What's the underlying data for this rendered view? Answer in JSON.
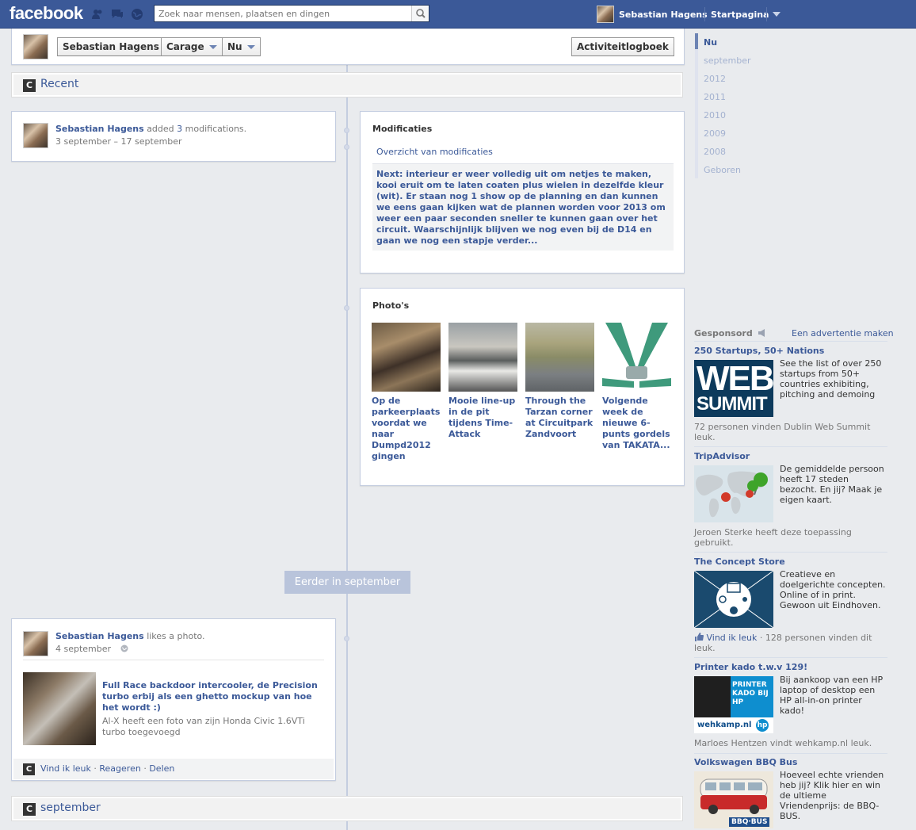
{
  "topbar": {
    "logo": "facebook",
    "search_placeholder": "Zoek naar mensen, plaatsen en dingen",
    "user_name": "Sebastian Hagens",
    "home_label": "Startpagina"
  },
  "cover_bar": {
    "name": "Sebastian Hagens",
    "section": "Carage",
    "time": "Nu",
    "activity_log": "Activiteitlogboek"
  },
  "sections": {
    "recent": "Recent",
    "september": "september"
  },
  "mods_story": {
    "author": "Sebastian Hagens",
    "action_pre": "added",
    "count": "3",
    "action_post": "modifications.",
    "date_range": "3 september – 17 september"
  },
  "mods_card": {
    "title": "Modificaties",
    "link": "Overzicht van modificaties",
    "body": "Next: interieur er weer volledig uit om netjes te maken, kooi eruit om te laten coaten plus wielen in dezelfde kleur (wit). Er staan nog 1 show op de planning en dan kunnen we eens gaan kijken wat de plannen worden voor 2013 om weer een paar seconden sneller te kunnen gaan over het circuit. Waarschijnlijk blijven we nog even bij de D14 en gaan we nog een stapje verder..."
  },
  "photos_card": {
    "title": "Photo's",
    "items": [
      {
        "caption": "Op de parkeerplaats voordat we naar Dumpd2012 gingen"
      },
      {
        "caption": "Mooie line-up in de pit tijdens Time-Attack"
      },
      {
        "caption": "Through the Tarzan corner at Circuitpark Zandvoort"
      },
      {
        "caption": "Volgende week de nieuwe 6-punts gordels van TAKATA..."
      }
    ]
  },
  "divider": {
    "label": "Eerder in september"
  },
  "like_story": {
    "author": "Sebastian Hagens",
    "action": "likes a photo.",
    "date": "4 september",
    "link_title": "Full Race backdoor intercooler, de Precision turbo erbij als een ghetto mockup van hoe het wordt :)",
    "link_desc": "Al-X heeft een foto van zijn Honda Civic 1.6VTi turbo toegevoegd",
    "actions": {
      "like": "Vind ik leuk",
      "comment": "Reageren",
      "share": "Delen"
    }
  },
  "scrubber": {
    "items": [
      "Nu",
      "september",
      "2012",
      "2011",
      "2010",
      "2009",
      "2008",
      "Geboren"
    ]
  },
  "ads": {
    "header": "Gesponsord",
    "create": "Een advertentie maken",
    "items": [
      {
        "title": "250 Startups, 50+ Nations",
        "image_text_1": "WEB",
        "image_text_2": "SUMMIT",
        "text": "See the list of over 250 startups from 50+ countries exhibiting, pitching and demoing",
        "foot": "72 personen vinden Dublin Web Summit leuk."
      },
      {
        "title": "TripAdvisor",
        "text": "De gemiddelde persoon heeft 17 steden bezocht. En jij? Maak je eigen kaart.",
        "foot": "Jeroen Sterke heeft deze toepassing gebruikt."
      },
      {
        "title": "The Concept Store",
        "text": "Creatieve en doelgerichte concepten. Online of in print. Gewoon uit Eindhoven.",
        "foot_link": "Vind ik leuk",
        "foot": "· 128 personen vinden dit leuk."
      },
      {
        "title": "Printer kado t.w.v 129!",
        "image_text_1": "PRINTER KADO BIJ HP",
        "image_text_2": "wehkamp.nl",
        "text": "Bij aankoop van een HP laptop of desktop een HP all-in-on printer kado!",
        "foot": "Marloes Hentzen vindt wehkamp.nl leuk."
      },
      {
        "title": "Volkswagen BBQ Bus",
        "image_text_1": "BBQ·BUS",
        "text": "Hoeveel echte vrienden heb jij? Klik hier en win de ultieme Vriendenprijs: de BBQ-BUS."
      }
    ]
  }
}
